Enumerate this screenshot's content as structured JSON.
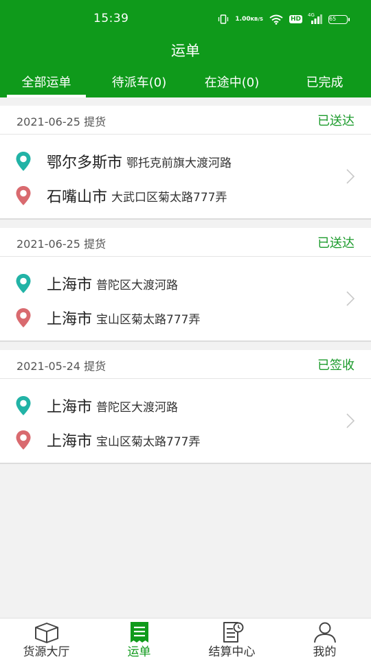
{
  "status_bar": {
    "time": "15:39",
    "speed_value": "1.00",
    "speed_unit": "KB/S",
    "hd": "HD",
    "network": "4G",
    "battery": "65"
  },
  "header": {
    "title": "运单"
  },
  "tabs": [
    {
      "label": "全部运单",
      "active": true
    },
    {
      "label": "待派车(0)",
      "active": false
    },
    {
      "label": "在途中(0)",
      "active": false
    },
    {
      "label": "已完成",
      "active": false
    }
  ],
  "orders": [
    {
      "date": "2021-06-25 提货",
      "status": "已送达",
      "from": {
        "city": "鄂尔多斯市",
        "address": "鄂托克前旗大渡河路"
      },
      "to": {
        "city": "石嘴山市",
        "address": "大武口区菊太路777弄"
      }
    },
    {
      "date": "2021-06-25 提货",
      "status": "已送达",
      "from": {
        "city": "上海市",
        "address": "普陀区大渡河路"
      },
      "to": {
        "city": "上海市",
        "address": "宝山区菊太路777弄"
      }
    },
    {
      "date": "2021-05-24 提货",
      "status": "已签收",
      "from": {
        "city": "上海市",
        "address": "普陀区大渡河路"
      },
      "to": {
        "city": "上海市",
        "address": "宝山区菊太路777弄"
      }
    }
  ],
  "bottom_nav": [
    {
      "label": "货源大厅",
      "icon": "box-icon",
      "active": false
    },
    {
      "label": "运单",
      "icon": "document-icon",
      "active": true
    },
    {
      "label": "结算中心",
      "icon": "invoice-clock-icon",
      "active": false
    },
    {
      "label": "我的",
      "icon": "user-icon",
      "active": false
    }
  ],
  "colors": {
    "brand_green": "#0f9a1b",
    "origin_pin": "#22b3a6",
    "dest_pin": "#d96a6f",
    "status_text": "#1a9a2a"
  }
}
